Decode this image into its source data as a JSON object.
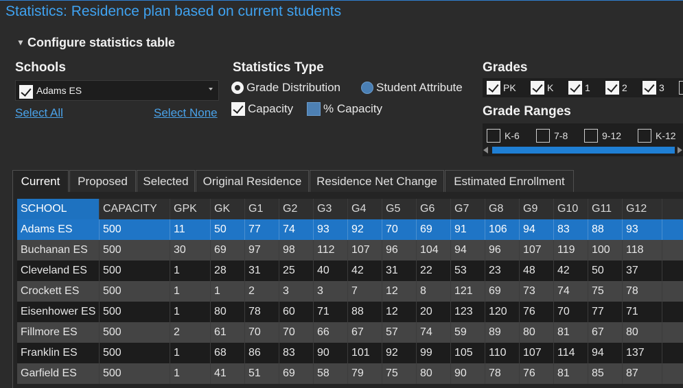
{
  "title": "Statistics: Residence plan based on current students",
  "configure_label": "Configure statistics table",
  "schools": {
    "heading": "Schools",
    "selected_value": "Adams ES",
    "select_all": "Select All",
    "select_none": "Select None"
  },
  "stats_type": {
    "heading": "Statistics Type",
    "grade_distribution": "Grade Distribution",
    "student_attribute": "Student Attribute",
    "capacity": "Capacity",
    "pct_capacity": "% Capacity"
  },
  "grades": {
    "heading": "Grades",
    "items": [
      "PK",
      "K",
      "1",
      "2",
      "3"
    ]
  },
  "grade_ranges": {
    "heading": "Grade Ranges",
    "items": [
      "K-6",
      "7-8",
      "9-12",
      "K-12"
    ]
  },
  "tabs": [
    "Current",
    "Proposed",
    "Selected",
    "Original Residence",
    "Residence Net Change",
    "Estimated Enrollment"
  ],
  "table": {
    "columns": [
      "SCHOOL",
      "CAPACITY",
      "GPK",
      "GK",
      "G1",
      "G2",
      "G3",
      "G4",
      "G5",
      "G6",
      "G7",
      "G8",
      "G9",
      "G10",
      "G11",
      "G12"
    ],
    "rows": [
      [
        "Adams ES",
        "500",
        "11",
        "50",
        "77",
        "74",
        "93",
        "92",
        "70",
        "69",
        "91",
        "106",
        "94",
        "83",
        "88",
        "93"
      ],
      [
        "Buchanan ES",
        "500",
        "30",
        "69",
        "97",
        "98",
        "112",
        "107",
        "96",
        "104",
        "94",
        "96",
        "107",
        "119",
        "100",
        "118"
      ],
      [
        "Cleveland ES",
        "500",
        "1",
        "28",
        "31",
        "25",
        "40",
        "42",
        "31",
        "22",
        "53",
        "23",
        "48",
        "42",
        "50",
        "37"
      ],
      [
        "Crockett ES",
        "500",
        "1",
        "1",
        "2",
        "3",
        "3",
        "7",
        "12",
        "8",
        "121",
        "69",
        "73",
        "74",
        "75",
        "78"
      ],
      [
        "Eisenhower ES",
        "500",
        "1",
        "80",
        "78",
        "60",
        "71",
        "88",
        "12",
        "20",
        "123",
        "120",
        "76",
        "70",
        "77",
        "71"
      ],
      [
        "Fillmore ES",
        "500",
        "2",
        "61",
        "70",
        "70",
        "66",
        "67",
        "57",
        "74",
        "59",
        "89",
        "80",
        "81",
        "67",
        "80"
      ],
      [
        "Franklin ES",
        "500",
        "1",
        "68",
        "86",
        "83",
        "90",
        "101",
        "92",
        "99",
        "105",
        "110",
        "107",
        "114",
        "94",
        "137"
      ],
      [
        "Garfield ES",
        "500",
        "1",
        "41",
        "51",
        "69",
        "58",
        "79",
        "75",
        "80",
        "90",
        "78",
        "76",
        "81",
        "85",
        "87"
      ]
    ]
  }
}
